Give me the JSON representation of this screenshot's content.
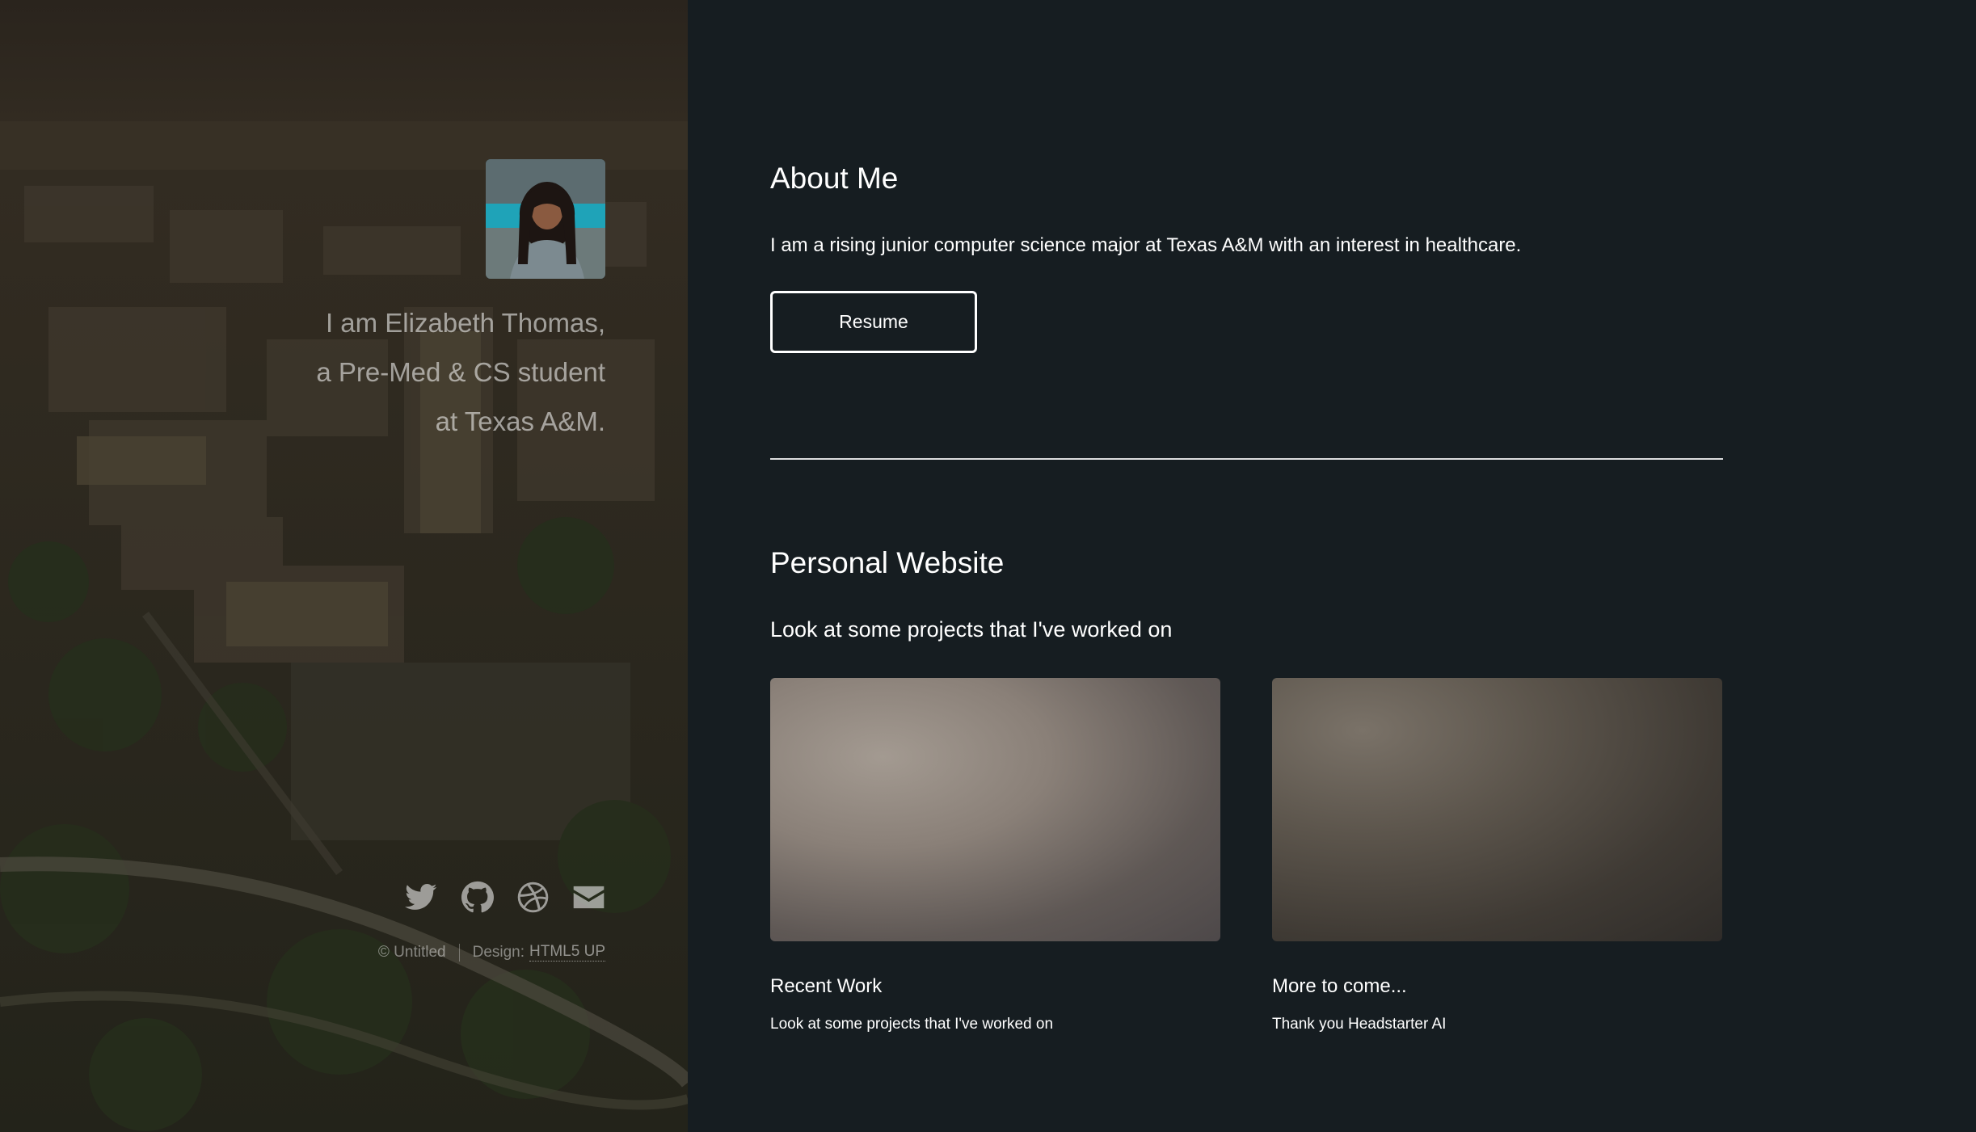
{
  "header": {
    "intro_line_1": "I am Elizabeth Thomas,",
    "intro_line_2": "a Pre-Med & CS student",
    "intro_line_3": "at Texas A&M.",
    "social": [
      {
        "icon": "twitter-icon"
      },
      {
        "icon": "github-icon"
      },
      {
        "icon": "dribbble-icon"
      },
      {
        "icon": "envelope-icon"
      }
    ],
    "copyright": "© Untitled",
    "design_label": "Design:",
    "design_link": "HTML5 UP"
  },
  "about": {
    "title": "About Me",
    "text": "I am a rising junior computer science major at Texas A&M with an interest in healthcare.",
    "resume_button": "Resume"
  },
  "work": {
    "title": "Personal Website",
    "lead": "Look at some projects that I've worked on",
    "cards": [
      {
        "title": "Recent Work",
        "text": "Look at some projects that I've worked on"
      },
      {
        "title": "More to come...",
        "text": "Thank you Headstarter AI"
      }
    ]
  },
  "colors": {
    "main_background": "#161d21",
    "text": "#ffffff"
  }
}
